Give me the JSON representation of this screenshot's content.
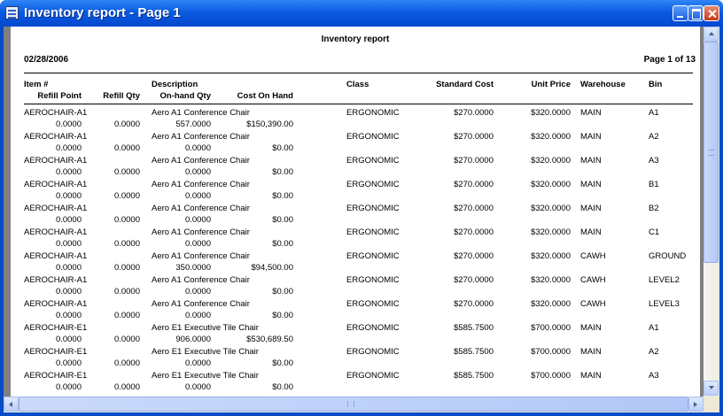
{
  "window": {
    "title": "Inventory report - Page 1"
  },
  "report": {
    "title": "Inventory report",
    "date": "02/28/2006",
    "page_label": "Page 1 of 13",
    "headers": {
      "item": "Item #",
      "refill_point": "Refill Point",
      "refill_qty": "Refill Qty",
      "description": "Description",
      "onhand_qty": "On-hand Qty",
      "cost_on_hand": "Cost On Hand",
      "class": "Class",
      "standard_cost": "Standard Cost",
      "unit_price": "Unit Price",
      "warehouse": "Warehouse",
      "bin": "Bin"
    },
    "rows": [
      {
        "item": "AEROCHAIR-A1",
        "desc": "Aero A1 Conference Chair",
        "class": "ERGONOMIC",
        "std": "$270.0000",
        "price": "$320.0000",
        "wh": "MAIN",
        "bin": "A1",
        "refill_point": "0.0000",
        "refill_qty": "0.0000",
        "onhand": "557.0000",
        "cost": "$150,390.00"
      },
      {
        "item": "AEROCHAIR-A1",
        "desc": "Aero A1 Conference Chair",
        "class": "ERGONOMIC",
        "std": "$270.0000",
        "price": "$320.0000",
        "wh": "MAIN",
        "bin": "A2",
        "refill_point": "0.0000",
        "refill_qty": "0.0000",
        "onhand": "0.0000",
        "cost": "$0.00"
      },
      {
        "item": "AEROCHAIR-A1",
        "desc": "Aero A1 Conference Chair",
        "class": "ERGONOMIC",
        "std": "$270.0000",
        "price": "$320.0000",
        "wh": "MAIN",
        "bin": "A3",
        "refill_point": "0.0000",
        "refill_qty": "0.0000",
        "onhand": "0.0000",
        "cost": "$0.00"
      },
      {
        "item": "AEROCHAIR-A1",
        "desc": "Aero A1 Conference Chair",
        "class": "ERGONOMIC",
        "std": "$270.0000",
        "price": "$320.0000",
        "wh": "MAIN",
        "bin": "B1",
        "refill_point": "0.0000",
        "refill_qty": "0.0000",
        "onhand": "0.0000",
        "cost": "$0.00"
      },
      {
        "item": "AEROCHAIR-A1",
        "desc": "Aero A1 Conference Chair",
        "class": "ERGONOMIC",
        "std": "$270.0000",
        "price": "$320.0000",
        "wh": "MAIN",
        "bin": "B2",
        "refill_point": "0.0000",
        "refill_qty": "0.0000",
        "onhand": "0.0000",
        "cost": "$0.00"
      },
      {
        "item": "AEROCHAIR-A1",
        "desc": "Aero A1 Conference Chair",
        "class": "ERGONOMIC",
        "std": "$270.0000",
        "price": "$320.0000",
        "wh": "MAIN",
        "bin": "C1",
        "refill_point": "0.0000",
        "refill_qty": "0.0000",
        "onhand": "0.0000",
        "cost": "$0.00"
      },
      {
        "item": "AEROCHAIR-A1",
        "desc": "Aero A1 Conference Chair",
        "class": "ERGONOMIC",
        "std": "$270.0000",
        "price": "$320.0000",
        "wh": "CAWH",
        "bin": "GROUND",
        "refill_point": "0.0000",
        "refill_qty": "0.0000",
        "onhand": "350.0000",
        "cost": "$94,500.00"
      },
      {
        "item": "AEROCHAIR-A1",
        "desc": "Aero A1 Conference Chair",
        "class": "ERGONOMIC",
        "std": "$270.0000",
        "price": "$320.0000",
        "wh": "CAWH",
        "bin": "LEVEL2",
        "refill_point": "0.0000",
        "refill_qty": "0.0000",
        "onhand": "0.0000",
        "cost": "$0.00"
      },
      {
        "item": "AEROCHAIR-A1",
        "desc": "Aero A1 Conference Chair",
        "class": "ERGONOMIC",
        "std": "$270.0000",
        "price": "$320.0000",
        "wh": "CAWH",
        "bin": "LEVEL3",
        "refill_point": "0.0000",
        "refill_qty": "0.0000",
        "onhand": "0.0000",
        "cost": "$0.00"
      },
      {
        "item": "AEROCHAIR-E1",
        "desc": "Aero E1 Executive Tile Chair",
        "class": "ERGONOMIC",
        "std": "$585.7500",
        "price": "$700.0000",
        "wh": "MAIN",
        "bin": "A1",
        "refill_point": "0.0000",
        "refill_qty": "0.0000",
        "onhand": "906.0000",
        "cost": "$530,689.50"
      },
      {
        "item": "AEROCHAIR-E1",
        "desc": "Aero E1 Executive Tile Chair",
        "class": "ERGONOMIC",
        "std": "$585.7500",
        "price": "$700.0000",
        "wh": "MAIN",
        "bin": "A2",
        "refill_point": "0.0000",
        "refill_qty": "0.0000",
        "onhand": "0.0000",
        "cost": "$0.00"
      },
      {
        "item": "AEROCHAIR-E1",
        "desc": "Aero E1 Executive Tile Chair",
        "class": "ERGONOMIC",
        "std": "$585.7500",
        "price": "$700.0000",
        "wh": "MAIN",
        "bin": "A3",
        "refill_point": "0.0000",
        "refill_qty": "0.0000",
        "onhand": "0.0000",
        "cost": "$0.00"
      }
    ]
  }
}
